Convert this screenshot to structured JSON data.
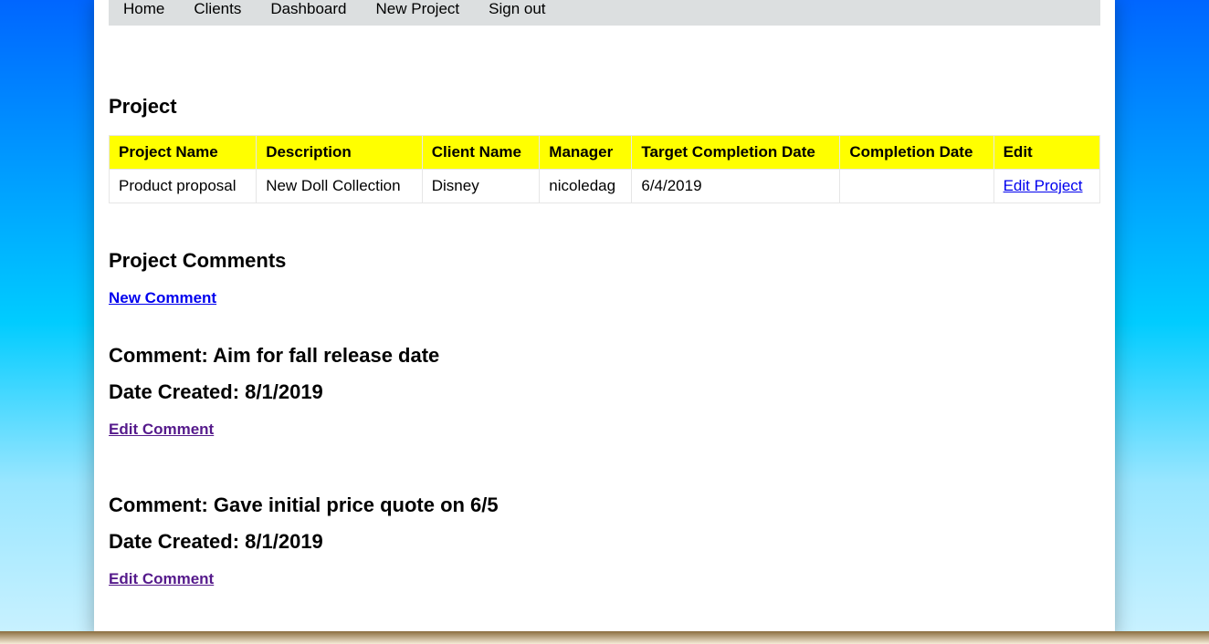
{
  "nav": {
    "items": [
      "Home",
      "Clients",
      "Dashboard",
      "New Project",
      "Sign out"
    ]
  },
  "project_section": {
    "title": "Project",
    "headers": [
      "Project Name",
      "Description",
      "Client Name",
      "Manager",
      "Target Completion Date",
      "Completion Date",
      "Edit"
    ],
    "row": {
      "project_name": "Product proposal",
      "description": "New Doll Collection",
      "client_name": "Disney",
      "manager": "nicoledag",
      "target_completion_date": "6/4/2019",
      "completion_date": "",
      "edit_label": "Edit Project"
    }
  },
  "comments_section": {
    "title": "Project Comments",
    "new_comment_label": "New Comment",
    "comment_prefix": "Comment: ",
    "date_prefix": "Date Created: ",
    "edit_label": "Edit Comment",
    "comments": [
      {
        "text": "Aim for fall release date",
        "date": "8/1/2019"
      },
      {
        "text": "Gave initial price quote on 6/5",
        "date": "8/1/2019"
      }
    ]
  }
}
